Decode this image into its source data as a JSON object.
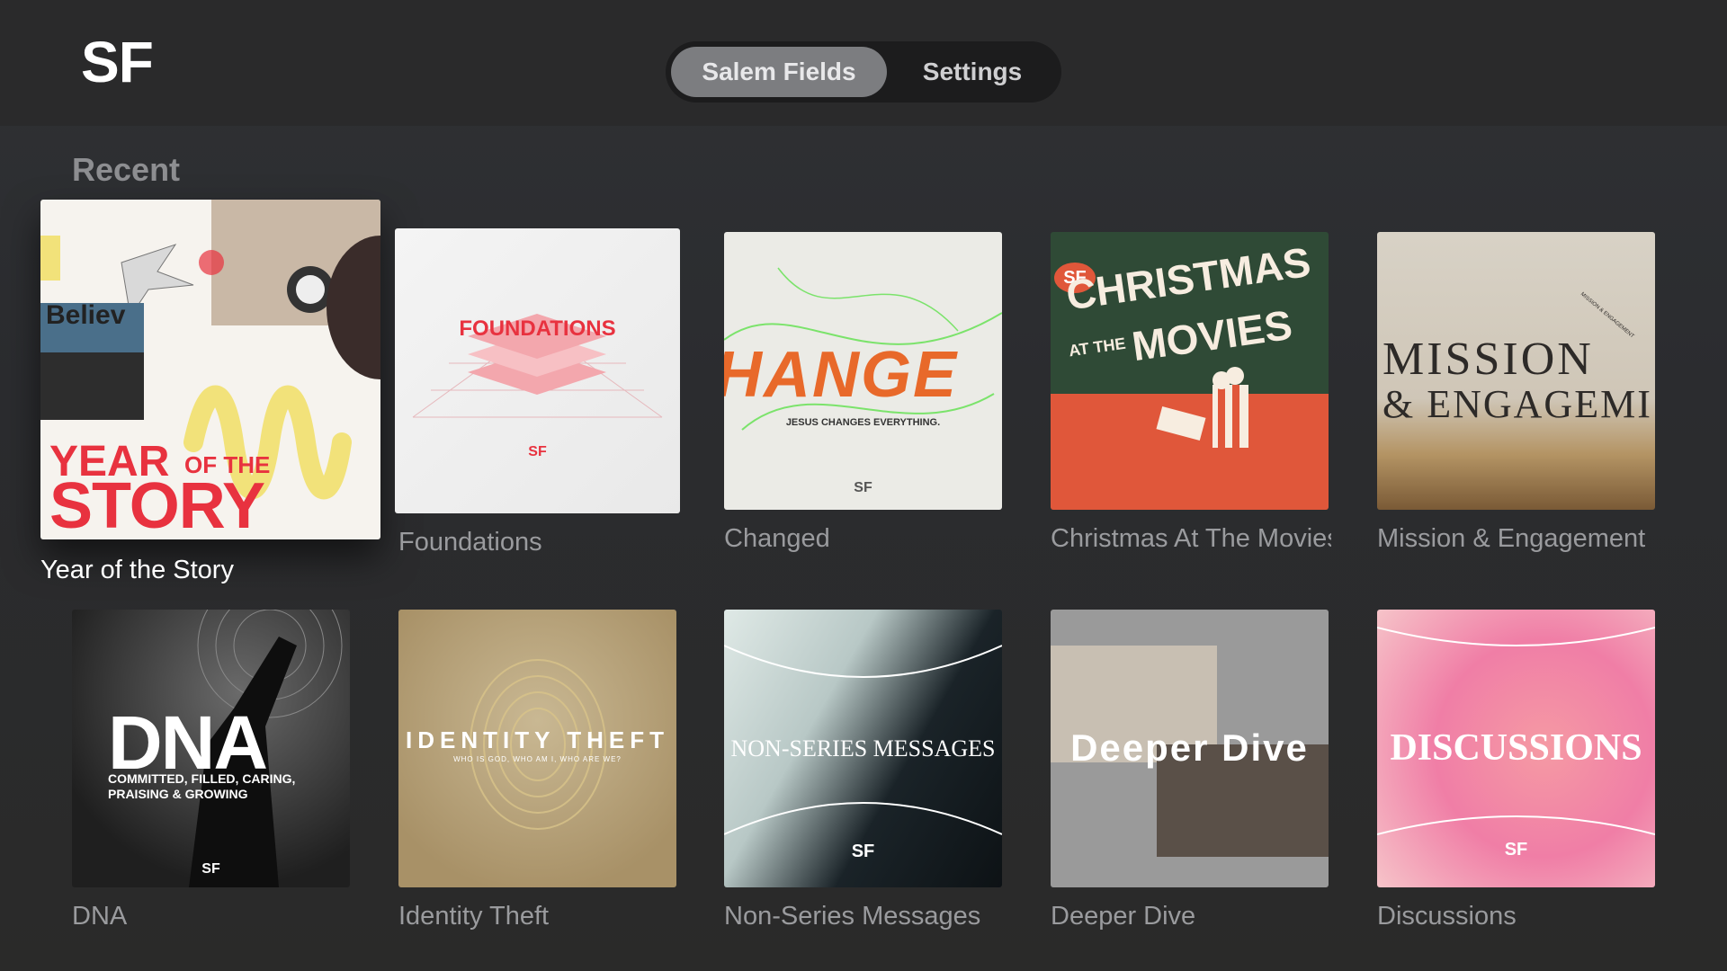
{
  "header": {
    "logo": "SF"
  },
  "tabs": [
    {
      "label": "Salem Fields",
      "active": true
    },
    {
      "label": "Settings",
      "active": false
    }
  ],
  "section": {
    "title": "Recent"
  },
  "tiles": [
    {
      "title": "Year of the Story",
      "art": {
        "word1": "Believ",
        "line1": "YEAR",
        "line1b": "OF THE",
        "line2": "STORY"
      }
    },
    {
      "title": "Foundations",
      "art": {
        "heading": "FOUNDATIONS",
        "mark": "SF"
      }
    },
    {
      "title": "Changed",
      "art": {
        "heading": "HANGE",
        "tagline": "JESUS CHANGES EVERYTHING.",
        "mark": "SF"
      }
    },
    {
      "title": "Christmas At The Movies",
      "art": {
        "badge": "SF",
        "line1": "CHRISTMAS",
        "line2a": "AT THE",
        "line2b": "MOVIES"
      }
    },
    {
      "title": "Mission & Engagement",
      "art": {
        "line1": "MISSION",
        "line2": "& ENGAGEMI",
        "ring": "MISSION & ENGAGEMENT"
      }
    },
    {
      "title": "DNA",
      "art": {
        "heading": "DNA",
        "line1": "COMMITTED, FILLED, CARING,",
        "line2": "PRAISING & GROWING",
        "mark": "SF"
      }
    },
    {
      "title": "Identity Theft",
      "art": {
        "heading": "IDENTITY THEFT",
        "tagline": "WHO IS GOD, WHO AM I, WHO ARE WE?"
      }
    },
    {
      "title": "Non-Series Messages",
      "art": {
        "heading": "NON-SERIES MESSAGES",
        "mark": "SF"
      }
    },
    {
      "title": "Deeper Dive",
      "art": {
        "heading": "Deeper Dive"
      }
    },
    {
      "title": "Discussions",
      "art": {
        "heading": "DISCUSSIONS",
        "mark": "SF"
      }
    }
  ],
  "colors": {
    "accent_red": "#e8323f",
    "christmas_green": "#2f4a36",
    "christmas_orange": "#e0573a",
    "discussions_pink": "#f08aa6"
  }
}
